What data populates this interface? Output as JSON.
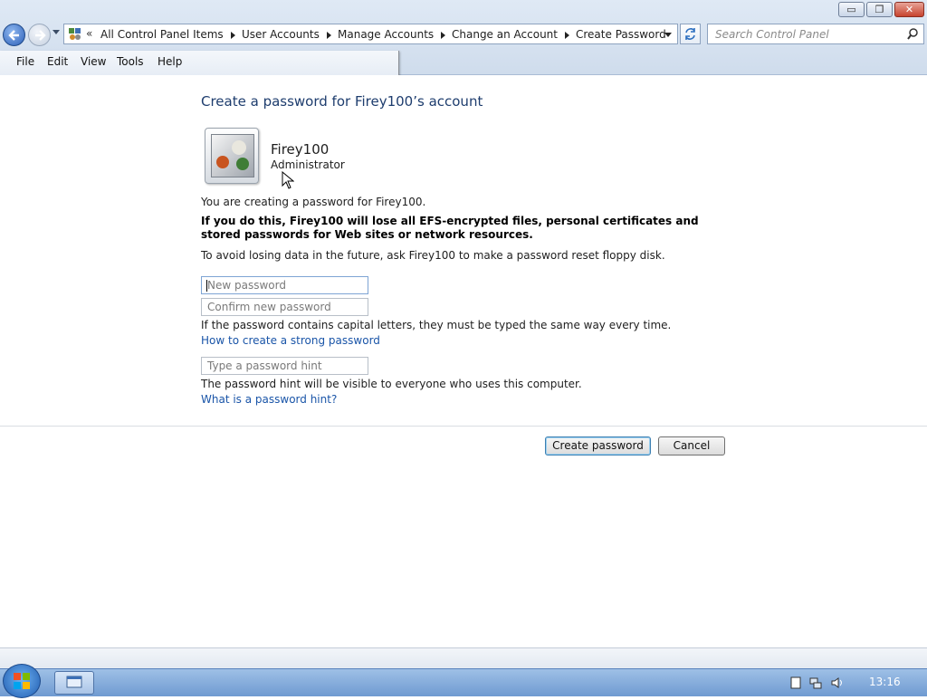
{
  "window": {
    "minimize_label": "▭",
    "maximize_label": "❐",
    "close_label": "✕"
  },
  "address": {
    "overflow": "«",
    "crumbs": [
      "All Control Panel Items",
      "User Accounts",
      "Manage Accounts",
      "Change an Account",
      "Create Password"
    ]
  },
  "search": {
    "placeholder": "Search Control Panel"
  },
  "menu": [
    "File",
    "Edit",
    "View",
    "Tools",
    "Help"
  ],
  "page": {
    "title": "Create a password for Firey100’s account",
    "user_name": "Firey100",
    "user_role": "Administrator",
    "intro": "You are creating a password for Firey100.",
    "warning": "If you do this, Firey100 will lose all EFS-encrypted files, personal certificates and stored passwords for Web sites or network resources.",
    "advice": "To avoid losing data in the future, ask Firey100 to make a password reset floppy disk.",
    "new_password_placeholder": "New password",
    "confirm_password_placeholder": "Confirm new password",
    "caps_note": "If the password contains capital letters, they must be typed the same way every time.",
    "strong_link": "How to create a strong password",
    "hint_placeholder": "Type a password hint",
    "hint_note": "The password hint will be visible to everyone who uses this computer.",
    "hint_link": "What is a password hint?",
    "create_button": "Create password",
    "cancel_button": "Cancel"
  },
  "taskbar": {
    "time": "13:16"
  }
}
